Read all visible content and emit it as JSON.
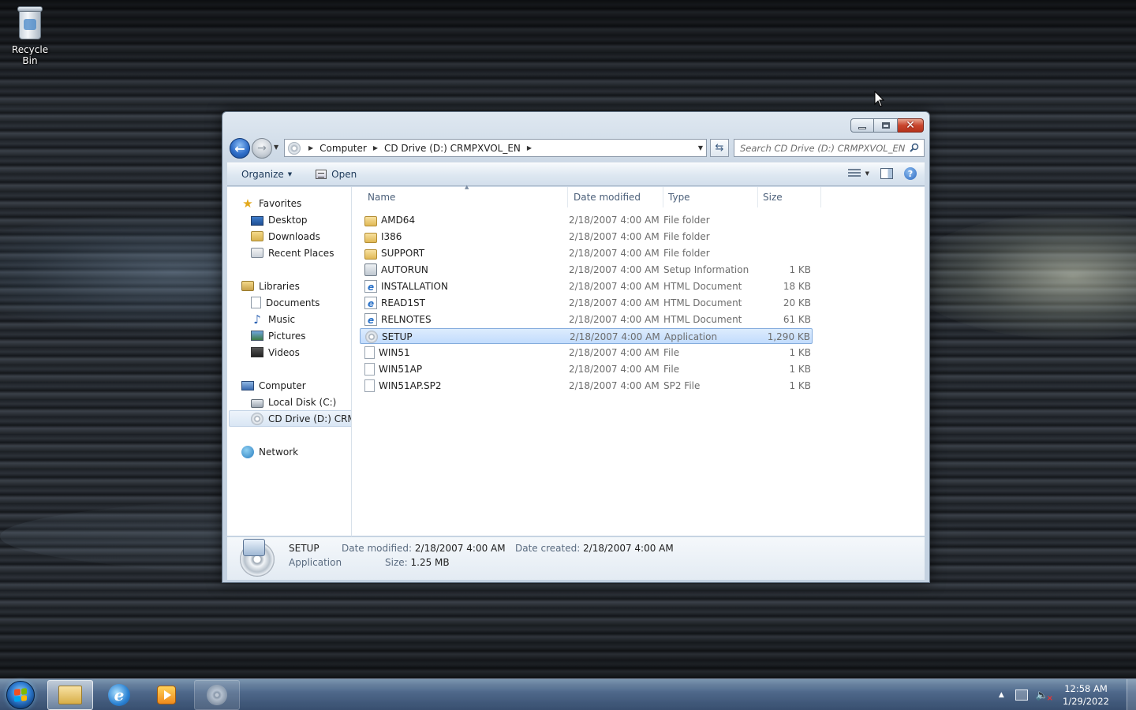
{
  "desktop": {
    "icons": [
      {
        "label": "Recycle Bin",
        "icon": "recycle-bin-icon"
      }
    ]
  },
  "window": {
    "address": {
      "crumbs": [
        "Computer",
        "CD Drive (D:) CRMPXVOL_EN"
      ]
    },
    "search": {
      "placeholder": "Search CD Drive (D:) CRMPXVOL_EN"
    },
    "toolbar": {
      "organize_label": "Organize",
      "open_label": "Open"
    },
    "navpane": {
      "favorites": {
        "label": "Favorites",
        "icon": "star-icon"
      },
      "favorites_items": [
        {
          "label": "Desktop",
          "icon": "desktop-icon"
        },
        {
          "label": "Downloads",
          "icon": "downloads-folder-icon"
        },
        {
          "label": "Recent Places",
          "icon": "recent-places-icon"
        }
      ],
      "libraries": {
        "label": "Libraries",
        "icon": "libraries-icon"
      },
      "libraries_items": [
        {
          "label": "Documents",
          "icon": "documents-icon"
        },
        {
          "label": "Music",
          "icon": "music-icon"
        },
        {
          "label": "Pictures",
          "icon": "pictures-icon"
        },
        {
          "label": "Videos",
          "icon": "videos-icon"
        }
      ],
      "computer": {
        "label": "Computer",
        "icon": "computer-icon"
      },
      "computer_items": [
        {
          "label": "Local Disk (C:)",
          "icon": "local-disk-icon"
        },
        {
          "label": "CD Drive (D:) CRMP:",
          "icon": "cd-drive-icon",
          "selected": true
        }
      ],
      "network": {
        "label": "Network",
        "icon": "network-icon"
      }
    },
    "columns": {
      "name": "Name",
      "date": "Date modified",
      "type": "Type",
      "size": "Size"
    },
    "files": [
      {
        "name": "AMD64",
        "date": "2/18/2007 4:00 AM",
        "type": "File folder",
        "size": "",
        "icon": "folder-icon"
      },
      {
        "name": "I386",
        "date": "2/18/2007 4:00 AM",
        "type": "File folder",
        "size": "",
        "icon": "folder-icon"
      },
      {
        "name": "SUPPORT",
        "date": "2/18/2007 4:00 AM",
        "type": "File folder",
        "size": "",
        "icon": "folder-icon"
      },
      {
        "name": "AUTORUN",
        "date": "2/18/2007 4:00 AM",
        "type": "Setup Information",
        "size": "1 KB",
        "icon": "setup-info-icon"
      },
      {
        "name": "INSTALLATION",
        "date": "2/18/2007 4:00 AM",
        "type": "HTML Document",
        "size": "18 KB",
        "icon": "html-document-icon"
      },
      {
        "name": "READ1ST",
        "date": "2/18/2007 4:00 AM",
        "type": "HTML Document",
        "size": "20 KB",
        "icon": "html-document-icon"
      },
      {
        "name": "RELNOTES",
        "date": "2/18/2007 4:00 AM",
        "type": "HTML Document",
        "size": "61 KB",
        "icon": "html-document-icon"
      },
      {
        "name": "SETUP",
        "date": "2/18/2007 4:00 AM",
        "type": "Application",
        "size": "1,290 KB",
        "icon": "setup-app-icon",
        "selected": true
      },
      {
        "name": "WIN51",
        "date": "2/18/2007 4:00 AM",
        "type": "File",
        "size": "1 KB",
        "icon": "file-icon"
      },
      {
        "name": "WIN51AP",
        "date": "2/18/2007 4:00 AM",
        "type": "File",
        "size": "1 KB",
        "icon": "file-icon"
      },
      {
        "name": "WIN51AP.SP2",
        "date": "2/18/2007 4:00 AM",
        "type": "SP2 File",
        "size": "1 KB",
        "icon": "file-icon"
      }
    ],
    "details": {
      "name": "SETUP",
      "type": "Application",
      "date_modified_label": "Date modified:",
      "date_modified": "2/18/2007 4:00 AM",
      "size_label": "Size:",
      "size": "1.25 MB",
      "date_created_label": "Date created:",
      "date_created": "2/18/2007 4:00 AM"
    }
  },
  "taskbar": {
    "items": [
      {
        "name": "windows-explorer",
        "icon": "explorer-folder-icon",
        "active": true
      },
      {
        "name": "internet-explorer",
        "icon": "internet-explorer-icon"
      },
      {
        "name": "media-player",
        "icon": "media-player-icon"
      },
      {
        "name": "cd-drive-window",
        "icon": "cd-drive-icon"
      }
    ],
    "clock": {
      "time": "12:58 AM",
      "date": "1/29/2022"
    }
  }
}
